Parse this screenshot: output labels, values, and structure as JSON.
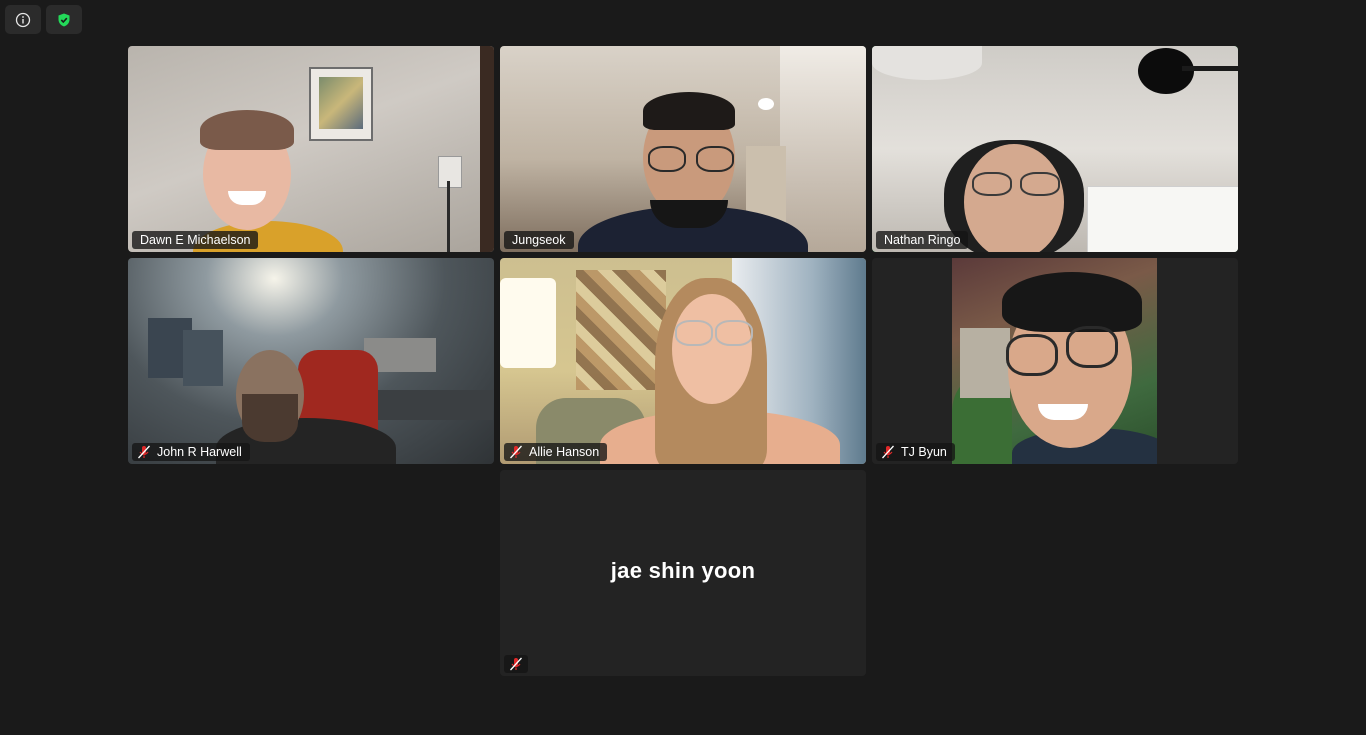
{
  "topbar": {
    "info_icon": "info-icon",
    "security_icon": "shield-check-icon",
    "security_color": "#23d959"
  },
  "participants": [
    {
      "name": "Dawn E Michaelson",
      "muted": false,
      "video": true
    },
    {
      "name": "Jungseok",
      "muted": false,
      "video": true
    },
    {
      "name": "Nathan Ringo",
      "muted": false,
      "video": true,
      "active_speaker": true
    },
    {
      "name": "John R Harwell",
      "muted": true,
      "video": true
    },
    {
      "name": "Allie Hanson",
      "muted": true,
      "video": true
    },
    {
      "name": "TJ Byun",
      "muted": true,
      "video": true
    },
    {
      "name": "jae shin yoon",
      "muted": true,
      "video": false
    }
  ],
  "colors": {
    "background": "#1a1a1a",
    "tile_empty": "#232323",
    "active_border": "#23d959",
    "mute_red": "#e02828"
  }
}
